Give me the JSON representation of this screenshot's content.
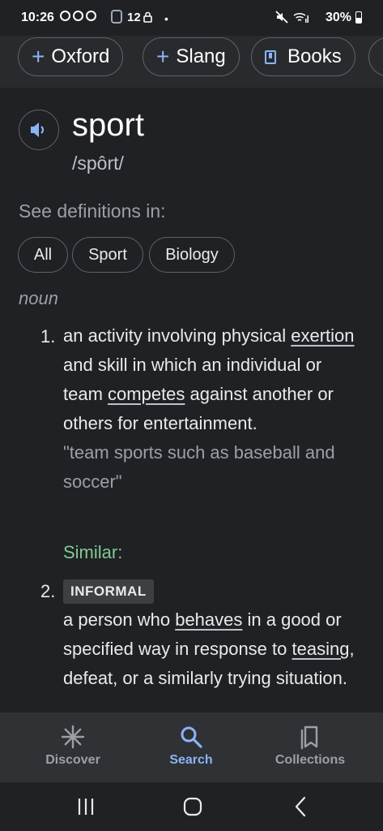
{
  "status_bar": {
    "time": "10:26",
    "notification_count": "12",
    "battery": "30%"
  },
  "chips": [
    {
      "label": "Oxford",
      "icon": "plus-icon"
    },
    {
      "label": "Slang",
      "icon": "plus-icon"
    },
    {
      "label": "Books",
      "icon": "book-icon"
    }
  ],
  "entry": {
    "word": "sport",
    "pronunciation": "/spôrt/",
    "see_definitions_label": "See definitions in:",
    "filters": [
      "All",
      "Sport",
      "Biology"
    ],
    "part_of_speech": "noun"
  },
  "definitions": [
    {
      "number": "1.",
      "parts": [
        "an activity involving physical ",
        "exertion",
        " and skill in which an individual or team ",
        "competes",
        " against another or others for entertainment."
      ],
      "example": "\"team sports such as baseball and soccer\"",
      "similar_label": "Similar:"
    },
    {
      "number": "2.",
      "tag": "INFORMAL",
      "parts": [
        "a person who ",
        "behaves",
        " in a good or specified way in response to ",
        "teasing",
        ", defeat, or a similarly trying situation."
      ]
    }
  ],
  "bottom_nav": [
    {
      "label": "Discover",
      "icon": "asterisk-icon",
      "active": false
    },
    {
      "label": "Search",
      "icon": "search-icon",
      "active": true
    },
    {
      "label": "Collections",
      "icon": "collections-icon",
      "active": false
    }
  ],
  "colors": {
    "background": "#202124",
    "accent": "#8ab4f8",
    "similar": "#81c995"
  }
}
